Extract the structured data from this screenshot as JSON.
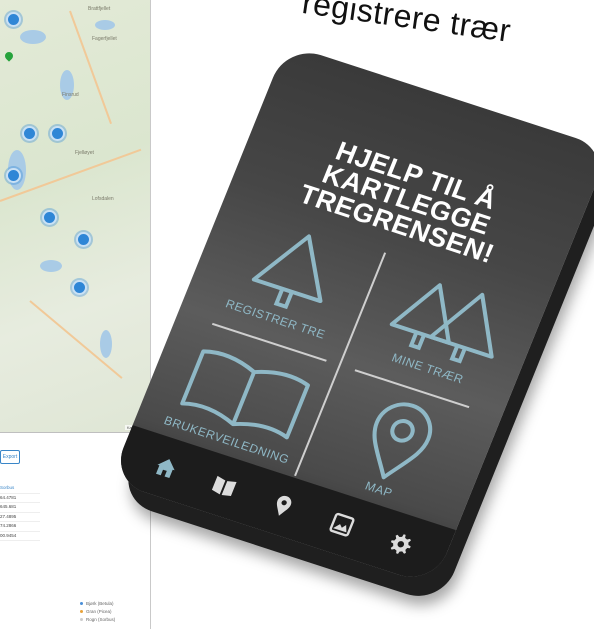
{
  "headline": "registrere trær",
  "background_page": {
    "map": {
      "attribution": "Kartdata ©",
      "place_labels": [
        "Brattfjellet",
        "Fagerfjellet",
        "Finsrud",
        "Fjelløyet",
        "Lofsdalen"
      ]
    },
    "export_label": "Export",
    "table": {
      "header": "Sorbus",
      "rows": [
        "64.4781",
        "645.681",
        "27.4895",
        "74.2866",
        "00.9454"
      ]
    },
    "legend": [
      {
        "label": "Bjørk (Betula)",
        "color": "#4a8fd8"
      },
      {
        "label": "Gran (Picea)",
        "color": "#e8a23a"
      },
      {
        "label": "Rogn (Sorbus)",
        "color": "#cccccc"
      }
    ]
  },
  "phone": {
    "title_lines": [
      "HJELP TIL Å",
      "KARTLEGGE",
      "TREGRENSEN!"
    ],
    "tiles": {
      "register": "REGISTRER TRE",
      "my_trees": "MINE TRÆR",
      "guide": "BRUKERVEILEDNING",
      "map": "MAP"
    },
    "nav_icons": [
      "home-icon",
      "book-icon",
      "location-pin-icon",
      "gallery-icon",
      "gear-icon"
    ],
    "accent_color": "#8fb8c6"
  }
}
